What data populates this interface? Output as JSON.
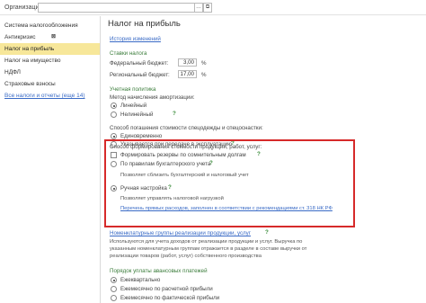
{
  "topbar": {
    "org_label": "Организация:",
    "org_value": "",
    "dropdown_glyph": "…",
    "link_glyph": "⧉"
  },
  "sidebar": {
    "items": [
      {
        "label": "Система налогообложения"
      },
      {
        "label": "Антикризис",
        "extra": "⊠"
      },
      {
        "label": "Налог на прибыль"
      },
      {
        "label": "Налог на имущество"
      },
      {
        "label": "НДФЛ"
      },
      {
        "label": "Страховые взносы"
      },
      {
        "label": "Все налоги и отчеты (еще 14)"
      }
    ]
  },
  "main": {
    "title": "Налог на прибыль",
    "history_link": "История изменений",
    "rates": {
      "section": "Ставки налога",
      "federal_label": "Федеральный бюджет:",
      "federal_value": "3,00",
      "regional_label": "Региональный бюджет:",
      "regional_value": "17,00",
      "percent": "%"
    },
    "policy": {
      "section": "Учетная политика",
      "method_label": "Метод начисления амортизации:",
      "linear": "Линейный",
      "nonlinear": "Нелинейный",
      "question": "?"
    },
    "workwear": {
      "label": "Способ погашения стоимости спецодежды и спецоснастки:",
      "once": "Единовременно",
      "in_use": "Указывается при передаче в эксплуатацию"
    },
    "reserves": {
      "label": "Формировать резервы по сомнительным долгам"
    },
    "cost": {
      "label": "Способ формирования стоимости продукции, работ, услуг:",
      "by_rules": "По правилам бухгалтерского учета",
      "by_rules_hint": "Позволяет сблизить бухгалтерский и налоговый учет",
      "manual": "Ручная настройка",
      "manual_hint": "Позволяет управлять налоговой нагрузкой",
      "direct_costs_link": "Перечень прямых расходов, заполнен в соответствии с рекомендациями ст. 318 НК РФ"
    },
    "nomenclature": {
      "link": "Номенклатурные группы реализации продукции, услуг",
      "desc1": "Используются для учета доходов от реализации продукции и услуг. Выручка по",
      "desc2": "указанным номенклатурным группам отражается в разделе в составе выручки от",
      "desc3": "реализации товаров (работ, услуг) собственного производства"
    },
    "payments": {
      "section": "Порядок уплаты авансовых платежей",
      "quarterly": "Ежеквартально",
      "monthly_calc": "Ежемесячно по расчетной прибыли",
      "monthly_actual": "Ежемесячно по фактической прибыли"
    }
  }
}
